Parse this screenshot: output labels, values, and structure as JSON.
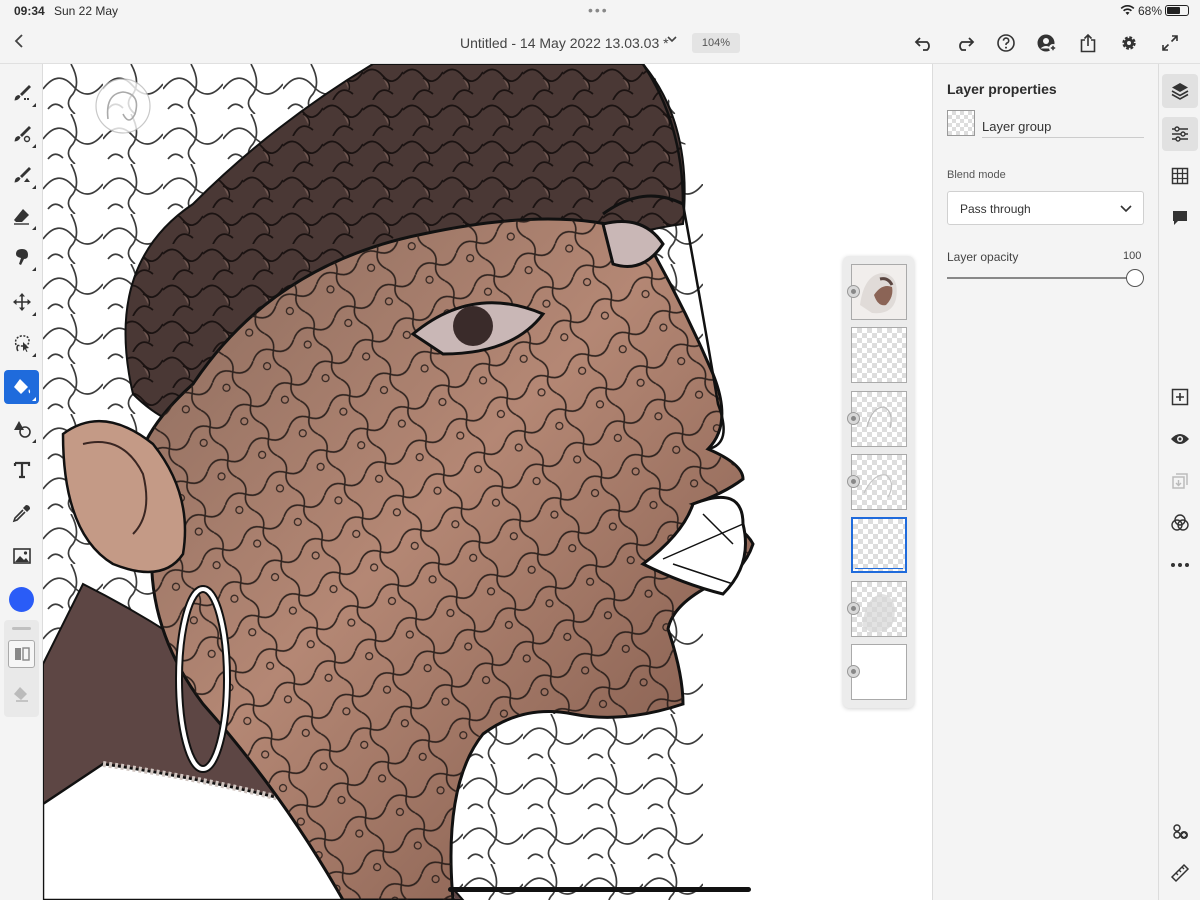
{
  "status_bar": {
    "time": "09:34",
    "date": "Sun 22 May",
    "battery_pct": "68%",
    "battery_level": 0.68
  },
  "title_bar": {
    "doc_title": "Untitled - 14 May 2022 13.03.03 *",
    "zoom": "104%",
    "actions": [
      "undo-icon",
      "redo-icon",
      "help-icon",
      "invite-icon",
      "share-icon",
      "settings-icon",
      "fullscreen-icon"
    ]
  },
  "tools": {
    "items": [
      "pixel-brush",
      "live-brush",
      "vector-brush",
      "eraser",
      "smudge",
      "move",
      "selection",
      "fill",
      "shapes",
      "text",
      "eyedropper",
      "image"
    ],
    "active": "fill",
    "current_color": "#2a5cf7",
    "accent_color": "#1f6bdc"
  },
  "layers": {
    "count": 7,
    "selected_index": 4
  },
  "properties": {
    "title": "Layer properties",
    "layer_name": "Layer group",
    "blend_mode_label": "Blend mode",
    "blend_mode_value": "Pass through",
    "opacity_label": "Layer opacity",
    "opacity_value": "100"
  },
  "right_column": {
    "icons": [
      "layers-icon",
      "properties-icon",
      "grid-icon",
      "comments-icon",
      "add-layer-icon",
      "visibility-icon",
      "import-icon",
      "blend-icon",
      "more-icon",
      "clone-icon",
      "ruler-icon"
    ]
  }
}
